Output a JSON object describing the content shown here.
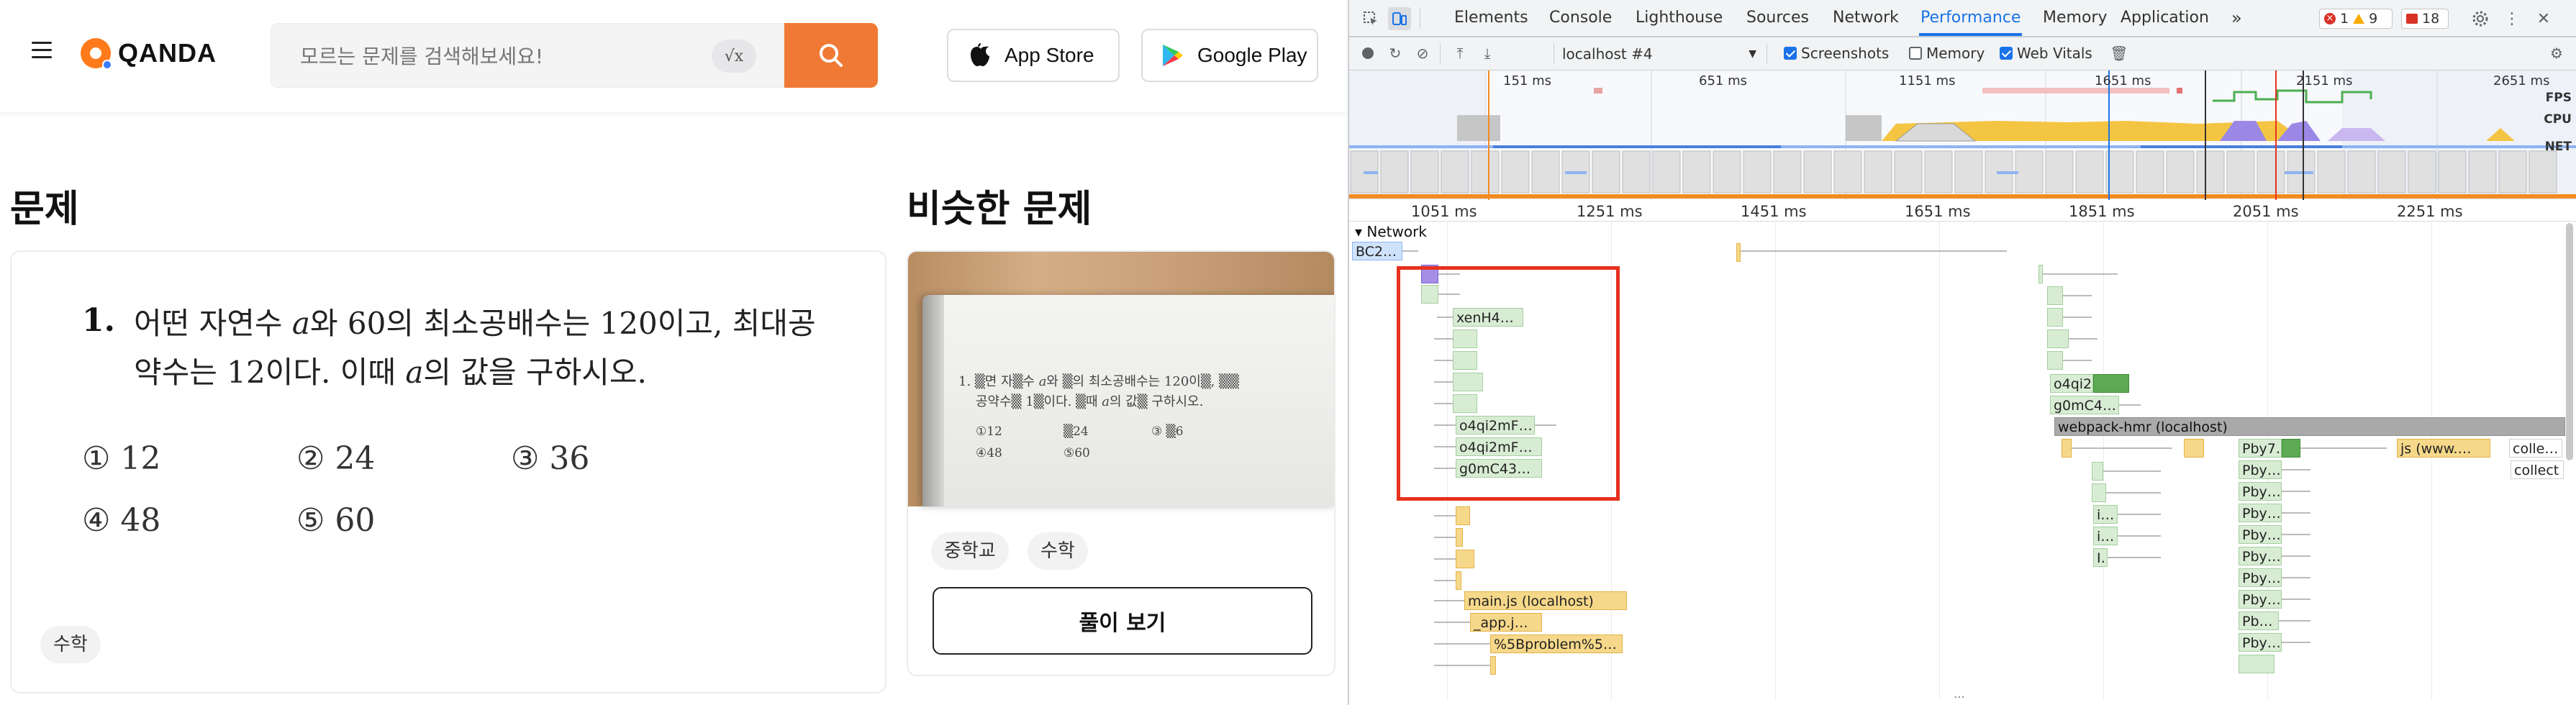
{
  "qanda": {
    "logo_text": "QANDA",
    "search": {
      "placeholder": "모르는 문제를 검색해보세요!",
      "math_button": "√x"
    },
    "app_store_label": "App Store",
    "google_play_label": "Google Play",
    "problem_section_title": "문제",
    "similar_section_title": "비슷한 문제",
    "problem": {
      "number": "1.",
      "text": "어떤 자연수 𝑎와 60의 최소공배수는 120이고, 최대공약수는 12이다. 이때 𝑎의 값을 구하시오.",
      "choices": [
        "① 12",
        "② 24",
        "③ 36",
        "④ 48",
        "⑤ 60"
      ],
      "tag": "수학"
    },
    "similar": {
      "thumb_line1": "1. ▒면 자▒수 𝑎와 ▒의 최소공배수는 120이▒, ▒▒",
      "thumb_line2": "공약수▒ 1▒이다.  ▒때 𝑎의 값▒ 구하시오.",
      "thumb_choices": [
        "①12",
        "▒24",
        "③ ▒6",
        "④48",
        "⑤60"
      ],
      "tags": [
        "중학교",
        "수학"
      ],
      "solve_button": "풀이 보기"
    }
  },
  "devtools": {
    "tabs": [
      "Elements",
      "Console",
      "Lighthouse",
      "Sources",
      "Network",
      "Performance",
      "Memory",
      "Application"
    ],
    "selected_tab": "Performance",
    "more_tabs": "»",
    "badges": {
      "errors": "1",
      "warnings": "9",
      "issues": "18"
    },
    "toolbar": {
      "target": "localhost #4",
      "screenshots_label": "Screenshots",
      "memory_label": "Memory",
      "web_vitals_label": "Web Vitals",
      "screenshots_checked": true,
      "memory_checked": false,
      "web_vitals_checked": true
    },
    "overview_ticks": [
      "151 ms",
      "651 ms",
      "1151 ms",
      "1651 ms",
      "2151 ms",
      "2651 ms"
    ],
    "overview_labels": [
      "FPS",
      "CPU",
      "NET"
    ],
    "ruler_ticks": [
      "1051 ms",
      "1251 ms",
      "1451 ms",
      "1651 ms",
      "1851 ms",
      "2051 ms",
      "2251 ms"
    ],
    "network_label": "Network",
    "bars": {
      "bc2": "BC2…",
      "xenh4": "xenH4…",
      "o4qi_a": "o4qi2mF…",
      "o4qi_b": "o4qi2mF…",
      "g0mc_a": "g0mC43…",
      "mainjs": "main.js (localhost)",
      "appjs": "_app.j…",
      "problem": "%5Bproblem%5…",
      "o4qi_c": "o4qi2…",
      "g0mc_b": "g0mC4…",
      "webpack": "webpack-hmr (localhost)",
      "pby7": "Pby7…",
      "js_www": "js (www.…",
      "collect_a": "colle…",
      "collect_b": "collect",
      "pby_list": [
        "Pby…",
        "Pby…",
        "Pby…",
        "Pby…",
        "Pby…",
        "Pby…",
        "Pby…",
        "Pb…",
        "Pby…"
      ],
      "i_list": [
        "i…",
        "i…",
        "I…"
      ]
    },
    "colors": {
      "accent": "#1a73e8",
      "highlight": "#e5321e",
      "search_button": "#f07a35"
    }
  }
}
